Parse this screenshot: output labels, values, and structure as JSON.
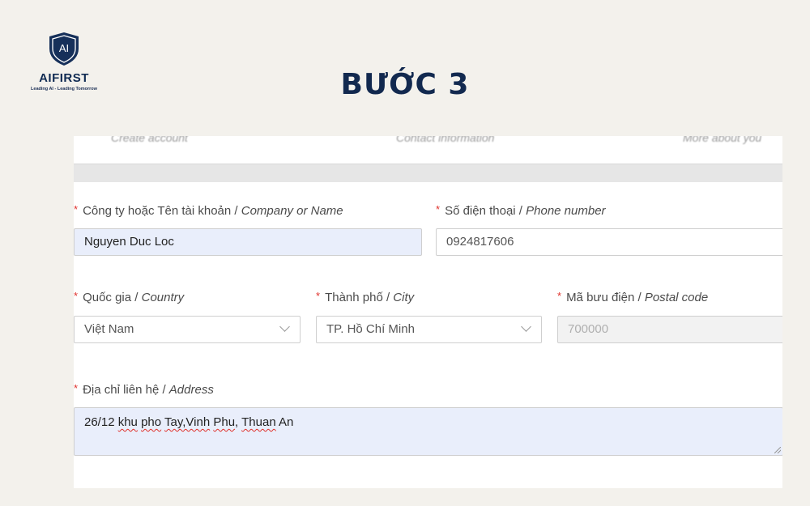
{
  "brand": {
    "logo_text": "AI",
    "name": "AIFIRST",
    "tagline": "Leading AI - Leading Tomorrow"
  },
  "heading": "BƯỚC 3",
  "steps": [
    "Create account",
    "Contact information",
    "More about you"
  ],
  "form": {
    "company": {
      "label": "Công ty hoặc Tên tài khoản / ",
      "label_en": "Company or Name",
      "value": "Nguyen Duc Loc"
    },
    "phone": {
      "label": "Số điện thoại / ",
      "label_en": "Phone number",
      "value": "0924817606"
    },
    "country": {
      "label": "Quốc gia / ",
      "label_en": "Country",
      "value": "Việt Nam"
    },
    "city": {
      "label": "Thành phố / ",
      "label_en": "City",
      "value": "TP. Hồ Chí Minh"
    },
    "postal": {
      "label": "Mã bưu điện / ",
      "label_en": "Postal code",
      "value": "700000"
    },
    "address": {
      "label": "Địa chỉ liên hệ / ",
      "label_en": "Address",
      "value": "26/12 khu pho Tay,Vinh Phu, Thuan An",
      "parts": [
        "26/12 ",
        "khu",
        " ",
        "pho",
        " ",
        "Tay,Vinh",
        " ",
        "Phu",
        ", ",
        "Thuan",
        " An"
      ]
    }
  },
  "colors": {
    "navy": "#12294f",
    "required": "#e0312b",
    "filled_bg": "#e9eefb"
  }
}
